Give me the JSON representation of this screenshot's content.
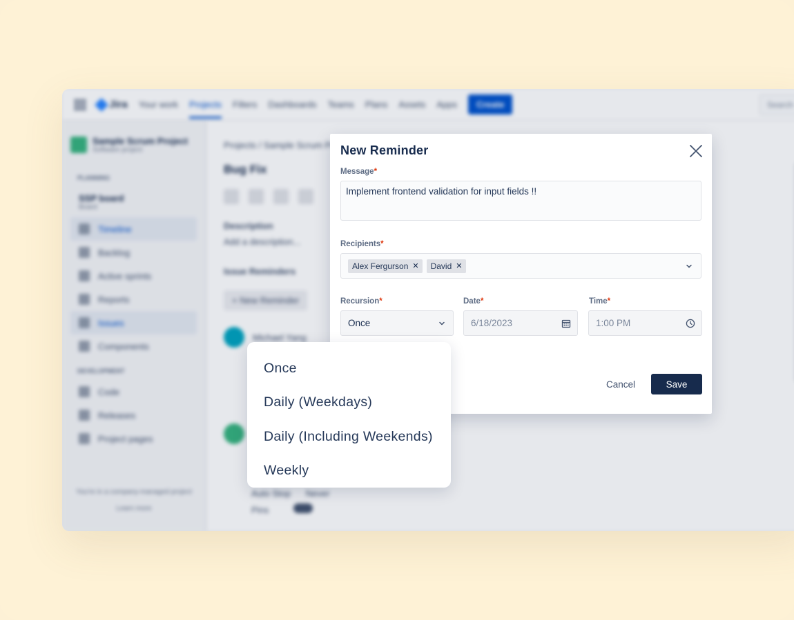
{
  "background_app": {
    "logo": "Jira",
    "nav": [
      "Your work",
      "Projects",
      "Filters",
      "Dashboards",
      "Teams",
      "Plans",
      "Assets",
      "Apps"
    ],
    "create_label": "Create",
    "search_placeholder": "Search",
    "project_name": "Sample Scrum Project",
    "project_type": "Software project",
    "planning_label": "PLANNING",
    "board_name": "SSP board",
    "board_sub": "Board",
    "sidebar_items": [
      "Timeline",
      "Backlog",
      "Active sprints",
      "Reports",
      "Issues",
      "Components"
    ],
    "development_label": "DEVELOPMENT",
    "dev_items": [
      "Code",
      "Releases"
    ],
    "project_pages": "Project pages",
    "footer_text": "You're in a company-managed project",
    "learn_more": "Learn more",
    "breadcrumb_root": "Projects",
    "breadcrumb_project": "Sample Scrum Project",
    "issue_title": "Bug Fix",
    "description_label": "Description",
    "description_placeholder": "Add a description...",
    "reminders_label": "Issue Reminders",
    "new_reminder_btn": "+ New Reminder",
    "user_name": "Michael Yang",
    "auto_stop_label": "Auto Stop",
    "auto_stop_value": "Never",
    "pins_label": "Pins"
  },
  "modal": {
    "title": "New Reminder",
    "message_label": "Message",
    "message_value": "Implement frontend validation for input fields !!",
    "recipients_label": "Recipients",
    "recipients": [
      "Alex Fergurson",
      "David"
    ],
    "recursion_label": "Recursion",
    "recursion_value": "Once",
    "date_label": "Date",
    "date_value": "6/18/2023",
    "time_label": "Time",
    "time_value": "1:00 PM",
    "required_mark": "*",
    "cancel_label": "Cancel",
    "save_label": "Save"
  },
  "recursion_options": [
    "Once",
    "Daily (Weekdays)",
    "Daily (Including Weekends)",
    "Weekly"
  ],
  "colors": {
    "page_background": "#fef2d6",
    "primary": "#172b4d",
    "required": "#de350b",
    "jira_blue": "#0052cc"
  }
}
